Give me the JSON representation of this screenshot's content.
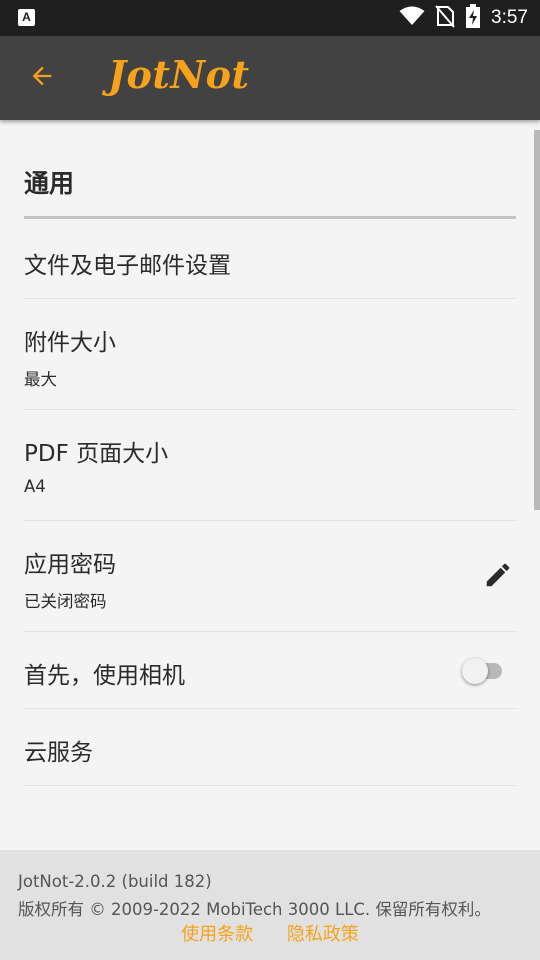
{
  "status_bar": {
    "app_badge": "A",
    "time": "3:57",
    "icons": [
      "wifi-icon",
      "no-sim-icon",
      "battery-charging-icon"
    ]
  },
  "app_bar": {
    "back_icon": "arrow-back-icon",
    "logo": "JotNot",
    "accent_color": "#f7a21b",
    "background_color": "#424242"
  },
  "settings": {
    "section_title": "通用",
    "files_email": {
      "title": "文件及电子邮件设置"
    },
    "attachment_size": {
      "title": "附件大小",
      "value": "最大"
    },
    "pdf_page_size": {
      "title": "PDF 页面大小",
      "value": "A4"
    },
    "app_passcode": {
      "title": "应用密码",
      "value": "已关闭密码",
      "action_icon": "pencil-icon"
    },
    "camera_first": {
      "title": "首先，使用相机",
      "enabled": false
    },
    "cloud_services": {
      "title": "云服务"
    }
  },
  "footer": {
    "version": "JotNot-2.0.2 (build 182)",
    "copyright": "版权所有 © 2009-2022 MobiTech 3000 LLC. 保留所有权利。",
    "terms_link": "使用条款",
    "privacy_link": "隐私政策"
  }
}
